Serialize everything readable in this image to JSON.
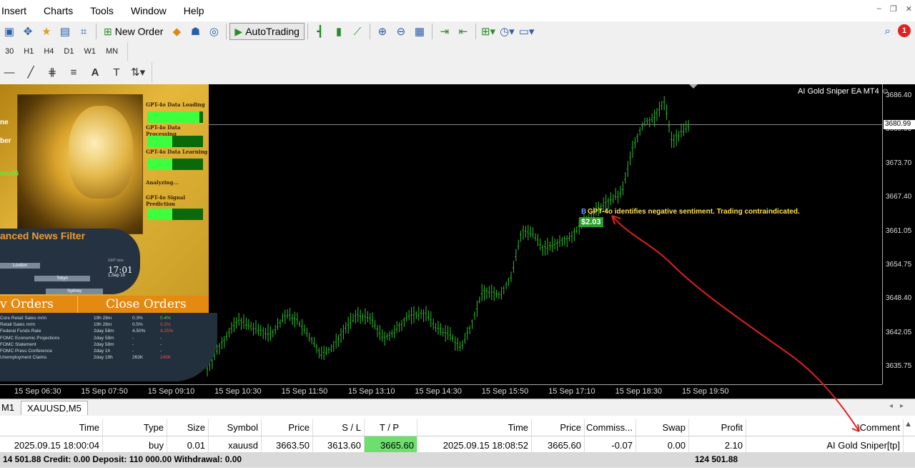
{
  "menu": [
    "Insert",
    "Charts",
    "Tools",
    "Window",
    "Help"
  ],
  "toolbar": {
    "new_order": "New Order",
    "autotrading": "AutoTrading"
  },
  "timeframes": [
    "30",
    "H1",
    "H4",
    "D1",
    "W1",
    "MN"
  ],
  "notifications": {
    "count": "1"
  },
  "chart": {
    "ea_title": "AI Gold Sniper EA MT4 ☺",
    "current_price": "3680.99",
    "price_labels": [
      "3686.40",
      "3680.05",
      "3673.70",
      "3667.40",
      "3661.05",
      "3654.75",
      "3648.40",
      "3642.05",
      "3635.75"
    ],
    "time_labels": [
      "15 Sep 06:30",
      "15 Sep 07:50",
      "15 Sep 09:10",
      "15 Sep 10:30",
      "15 Sep 11:50",
      "15 Sep 13:10",
      "15 Sep 14:30",
      "15 Sep 15:50",
      "15 Sep 17:10",
      "15 Sep 18:30",
      "15 Sep 19:50"
    ],
    "annotation": "GPT-4o identifies negative sentiment. Trading contraindicated.",
    "trade_marker": "B",
    "profit_tag": "$2.03"
  },
  "ea_panel": {
    "side_labels": [
      "ne",
      "ber",
      "mo06"
    ],
    "stage_labels": [
      "GPT-4o Data Loading",
      "GPT-4o Data Processing",
      "GPT-4o Data Learning",
      "Analyzing...",
      "GPT-4o Signal Prediction"
    ],
    "stage_progress": [
      0.94,
      0.45,
      0.45,
      null,
      0.45
    ],
    "news_title": "anced News Filter",
    "cities": [
      "London",
      "Tokyo",
      "Sydney"
    ],
    "gmt_label": "GMT time",
    "gmt_time": "17:01",
    "gmt_date": "1,Sep 15",
    "orders_left": "v Orders",
    "orders_right": "Close Orders",
    "news": [
      {
        "event": "Core Retail Sales m/m",
        "time": "19h 28m",
        "prev": "0.3%",
        "fc": "0.4%",
        "color": "#4cd94c"
      },
      {
        "event": "Retail Sales m/m",
        "time": "19h 28m",
        "prev": "0.5%",
        "fc": "0.2%",
        "color": "#e8504a"
      },
      {
        "event": "Federal Funds Rate",
        "time": "2day 58m",
        "prev": "4.50%",
        "fc": "4.25%",
        "color": "#e8504a"
      },
      {
        "event": "FOMC Economic Projections",
        "time": "2day 58m",
        "prev": "-",
        "fc": "-",
        "color": "#cdd"
      },
      {
        "event": "FOMC Statement",
        "time": "2day 58m",
        "prev": "-",
        "fc": "-",
        "color": "#cdd"
      },
      {
        "event": "FOMC Press Conference",
        "time": "2day 1h",
        "prev": "-",
        "fc": "-",
        "color": "#cdd"
      },
      {
        "event": "Unemployment Claims",
        "time": "2day 19h",
        "prev": "263K",
        "fc": "245K",
        "color": "#e8504a"
      }
    ]
  },
  "tabs": [
    "M1",
    "XAUUSD,M5"
  ],
  "terminal": {
    "headers": [
      "Time",
      "Type",
      "Size",
      "Symbol",
      "Price",
      "S / L",
      "T / P",
      "Time",
      "Price",
      "Commiss...",
      "Swap",
      "Profit",
      "Comment"
    ],
    "row": [
      "2025.09.15 18:00:04",
      "buy",
      "0.01",
      "xauusd",
      "3663.50",
      "3613.60",
      "3665.60",
      "2025.09.15 18:08:52",
      "3665.60",
      "-0.07",
      "0.00",
      "2.10",
      "AI Gold Sniper[tp]"
    ],
    "summary": "14 501.88  Credit: 0.00  Deposit: 110 000.00  Withdrawal: 0.00",
    "summary_profit": "124 501.88"
  },
  "colors": {
    "bull": "#2fbf2f",
    "accent_gold": "#e5b73a",
    "tp_green": "#6ddf6d",
    "arrow": "#e02020"
  }
}
